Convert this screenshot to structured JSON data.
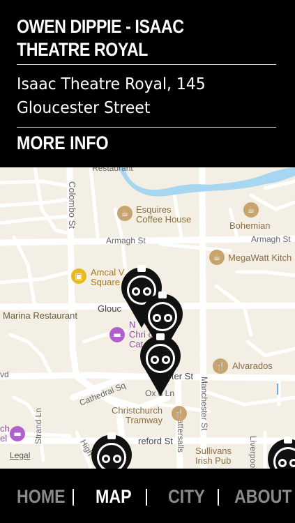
{
  "header": {
    "title": "OWEN DIPPIE - ISAAC THEATRE ROYAL",
    "address": "Isaac Theatre Royal, 145 Gloucester Street",
    "more_info": "MORE INFO"
  },
  "map": {
    "streets": {
      "colombo": "Colombo St",
      "armagh_left": "Armagh St",
      "armagh_right": "Armagh St",
      "gloucester": "Glouc",
      "worcester": "W          ter St",
      "cathedral_sq": "Cathedral Sq",
      "oxford_ln": "Ox    d Ln",
      "hereford": "reford St",
      "manchester": "Manchester St",
      "tattersalls": "Tattersalls",
      "strand_ln": "Strand Ln",
      "liverpool": "Liverpool",
      "high": "High",
      "vd": "vd",
      "restaurant_top": "Restaurant"
    },
    "pois": {
      "esquires_1": "Esquires",
      "esquires_2": "Coffee House",
      "bohemian": "Bohemian",
      "megawatt": "MegaWatt Kitch",
      "amcal_1": "Amcal V",
      "amcal_2": "Square",
      "marina": "Marina Restaurant",
      "novotel_1": "N",
      "novotel_2": "Chri       ch",
      "novotel_3": "Cat              Square",
      "alvarados": "Alvarados",
      "tramway_1": "Christchurch",
      "tramway_2": "Tramway",
      "sullivans_1": "Sullivans",
      "sullivans_2": "Irish Pub",
      "hotel_left_1": "ch",
      "hotel_left_2": "el"
    },
    "legal": "Legal"
  },
  "nav": {
    "items": [
      "HOME",
      "MAP",
      "CITY",
      "ABOUT"
    ],
    "active": "MAP"
  },
  "colors": {
    "background": "#000000",
    "map_land": "#f4efe4",
    "river": "#a7d6f0",
    "nav_inactive": "#8a8a8a",
    "nav_active": "#ffffff"
  }
}
